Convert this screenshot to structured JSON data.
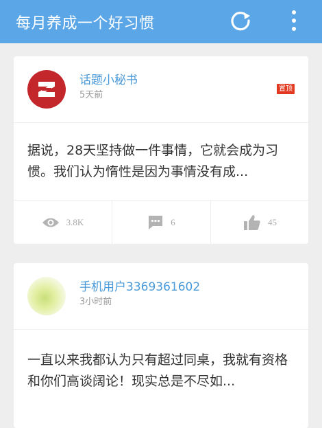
{
  "header": {
    "title": "每月养成一个好习惯"
  },
  "posts": [
    {
      "author": "话题小秘书",
      "time": "5天前",
      "badge": "置顶",
      "content": "据说，28天坚持做一件事情，它就会成为习惯。我们认为惰性是因为事情没有成...",
      "views": "3.8K",
      "comments": "6",
      "likes": "45"
    },
    {
      "author": "手机用户3369361602",
      "time": "3小时前",
      "content": "一直以来我都认为只有超过同桌，我就有资格和你们高谈阔论！现实总是不尽如..."
    }
  ],
  "colors": {
    "header": "#5aa6e6",
    "author": "#4a9ad9",
    "badge": "#e2381f"
  }
}
